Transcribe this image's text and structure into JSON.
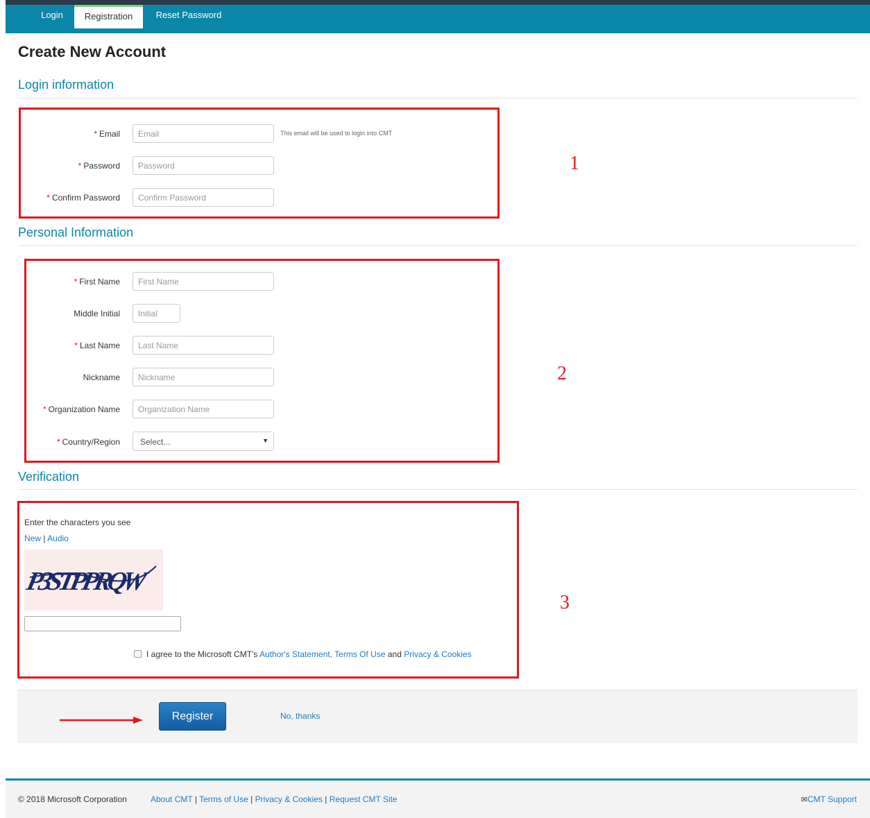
{
  "tabs": [
    {
      "label": "Login"
    },
    {
      "label": "Registration"
    },
    {
      "label": "Reset Password"
    }
  ],
  "page_title": "Create New Account",
  "required_mark": "*",
  "login_section": {
    "title": "Login information",
    "email": {
      "label": "Email",
      "placeholder": "Email",
      "help": "This email will be used to login into CMT"
    },
    "password": {
      "label": "Password",
      "placeholder": "Password"
    },
    "confirm_password": {
      "label": "Confirm Password",
      "placeholder": "Confirm Password"
    }
  },
  "personal_section": {
    "title": "Personal Information",
    "first_name": {
      "label": "First Name",
      "placeholder": "First Name"
    },
    "middle_initial": {
      "label": "Middle Initial",
      "placeholder": "Initial"
    },
    "last_name": {
      "label": "Last Name",
      "placeholder": "Last Name"
    },
    "nickname": {
      "label": "Nickname",
      "placeholder": "Nickname"
    },
    "organization": {
      "label": "Organization Name",
      "placeholder": "Organization Name"
    },
    "country": {
      "label": "Country/Region",
      "value": "Select..."
    }
  },
  "verification_section": {
    "title": "Verification",
    "prompt": "Enter the characters you see",
    "new_link": "New",
    "divider": "|",
    "audio_link": "Audio",
    "captcha_text": "P3STPPRQW",
    "agree_prefix": "I agree to the Microsoft CMT's",
    "authors_statement": "Author's Statement",
    "comma": ",",
    "terms_of_use": "Terms Of Use",
    "and": "and",
    "privacy": "Privacy & Cookies"
  },
  "annotations": {
    "box1": "1",
    "box2": "2",
    "box3": "3"
  },
  "actions": {
    "register": "Register",
    "no_thanks": "No, thanks"
  },
  "footer": {
    "copyright": "© 2018 Microsoft Corporation",
    "links": [
      "About CMT",
      "Terms of Use",
      "Privacy & Cookies",
      "Request CMT Site"
    ],
    "separator": "|",
    "support": "CMT Support"
  },
  "colors": {
    "accent": "#0a86a8",
    "annotation": "#e8141c",
    "link": "#1f7bbf",
    "button": "#1a6fb5"
  },
  "icons": {
    "select_caret": "caret-down-icon",
    "support": "envelope-icon",
    "pointer": "red-arrow"
  }
}
